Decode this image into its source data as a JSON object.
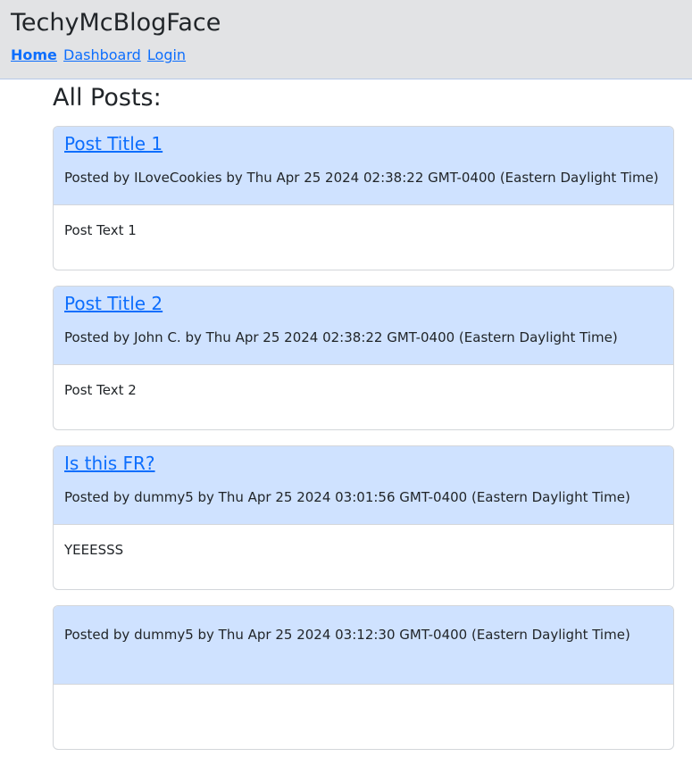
{
  "header": {
    "title": "TechyMcBlogFace",
    "nav": [
      {
        "label": "Home",
        "active": true
      },
      {
        "label": "Dashboard",
        "active": false
      },
      {
        "label": "Login",
        "active": false
      }
    ]
  },
  "main": {
    "heading": "All Posts:",
    "posts": [
      {
        "title": "Post Title 1",
        "meta": "Posted by ILoveCookies by Thu Apr 25 2024 02:38:22 GMT-0400 (Eastern Daylight Time)",
        "text": "Post Text 1"
      },
      {
        "title": "Post Title 2",
        "meta": "Posted by John C. by Thu Apr 25 2024 02:38:22 GMT-0400 (Eastern Daylight Time)",
        "text": "Post Text 2"
      },
      {
        "title": "Is this FR?",
        "meta": "Posted by dummy5 by Thu Apr 25 2024 03:01:56 GMT-0400 (Eastern Daylight Time)",
        "text": "YEEESSS"
      },
      {
        "title": "",
        "meta": "Posted by dummy5 by Thu Apr 25 2024 03:12:30 GMT-0400 (Eastern Daylight Time)",
        "text": ""
      }
    ]
  },
  "colors": {
    "header_bg": "#e2e3e5",
    "card_header_bg": "#cfe2ff",
    "link": "#0d6efd"
  }
}
